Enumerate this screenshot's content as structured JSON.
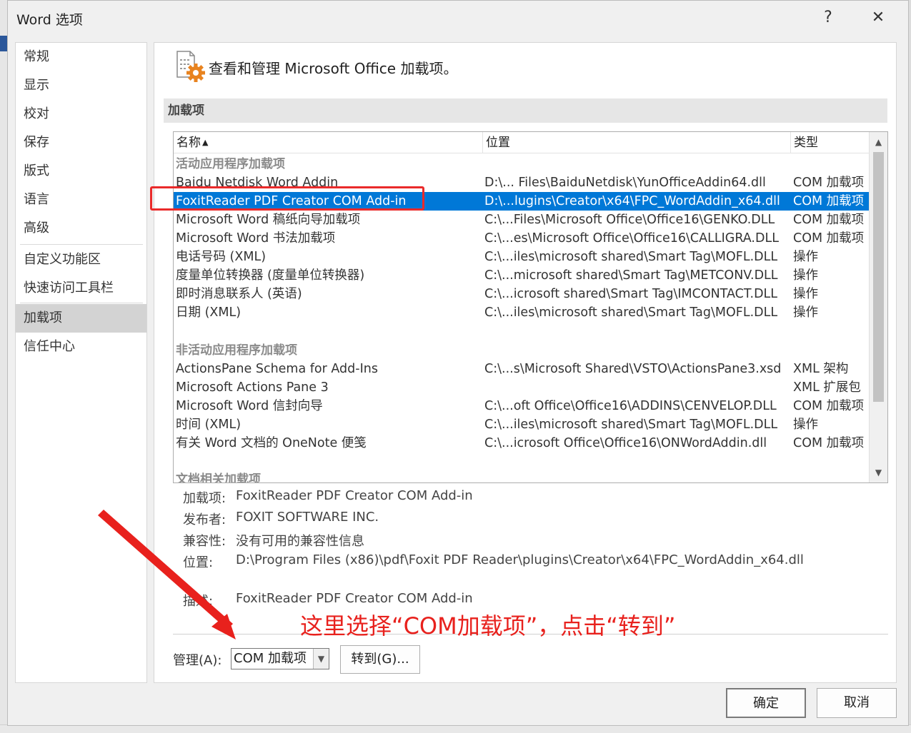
{
  "window": {
    "title": "Word 选项",
    "help": "?",
    "close": "✕"
  },
  "nav": {
    "items": [
      {
        "label": "常规"
      },
      {
        "label": "显示"
      },
      {
        "label": "校对"
      },
      {
        "label": "保存"
      },
      {
        "label": "版式"
      },
      {
        "label": "语言"
      },
      {
        "label": "高级"
      },
      {
        "label": "自定义功能区"
      },
      {
        "label": "快速访问工具栏"
      },
      {
        "label": "加载项",
        "active": true
      },
      {
        "label": "信任中心"
      }
    ]
  },
  "header": {
    "text": "查看和管理 Microsoft Office 加载项。",
    "icon": "addin-gear-icon"
  },
  "section": {
    "title": "加载项"
  },
  "list": {
    "columns": {
      "name": "名称",
      "sort": "▲",
      "location": "位置",
      "type": "类型"
    },
    "groups": {
      "active": "活动应用程序加载项",
      "inactive": "非活动应用程序加载项",
      "document": "文档相关加载项"
    },
    "active_rows": [
      {
        "name": "Baidu Netdisk Word Addin",
        "location": "D:\\... Files\\BaiduNetdisk\\YunOfficeAddin64.dll",
        "type": "COM 加载项"
      },
      {
        "name": "FoxitReader PDF Creator COM Add-in",
        "location": "D:\\...lugins\\Creator\\x64\\FPC_WordAddin_x64.dll",
        "type": "COM 加载项",
        "selected": true
      },
      {
        "name": "Microsoft Word 稿纸向导加载项",
        "location": "C:\\...Files\\Microsoft Office\\Office16\\GENKO.DLL",
        "type": "COM 加载项"
      },
      {
        "name": "Microsoft Word 书法加载项",
        "location": "C:\\...es\\Microsoft Office\\Office16\\CALLIGRA.DLL",
        "type": "COM 加载项"
      },
      {
        "name": "电话号码 (XML)",
        "location": "C:\\...iles\\microsoft shared\\Smart Tag\\MOFL.DLL",
        "type": "操作"
      },
      {
        "name": "度量单位转换器 (度量单位转换器)",
        "location": "C:\\...microsoft shared\\Smart Tag\\METCONV.DLL",
        "type": "操作"
      },
      {
        "name": "即时消息联系人 (英语)",
        "location": "C:\\...icrosoft shared\\Smart Tag\\IMCONTACT.DLL",
        "type": "操作"
      },
      {
        "name": "日期 (XML)",
        "location": "C:\\...iles\\microsoft shared\\Smart Tag\\MOFL.DLL",
        "type": "操作"
      }
    ],
    "inactive_rows": [
      {
        "name": "ActionsPane Schema for Add-Ins",
        "location": "C:\\...s\\Microsoft Shared\\VSTO\\ActionsPane3.xsd",
        "type": "XML 架构"
      },
      {
        "name": "Microsoft Actions Pane 3",
        "location": "",
        "type": "XML 扩展包"
      },
      {
        "name": "Microsoft Word 信封向导",
        "location": "C:\\...oft Office\\Office16\\ADDINS\\CENVELOP.DLL",
        "type": "COM 加载项"
      },
      {
        "name": "时间 (XML)",
        "location": "C:\\...iles\\microsoft shared\\Smart Tag\\MOFL.DLL",
        "type": "操作"
      },
      {
        "name": "有关 Word 文档的 OneNote 便笺",
        "location": "C:\\...icrosoft Office\\Office16\\ONWordAddin.dll",
        "type": "COM 加载项"
      }
    ]
  },
  "details": {
    "addin_label": "加载项:",
    "addin_value": "FoxitReader PDF Creator COM Add-in",
    "publisher_label": "发布者:",
    "publisher_value": "FOXIT SOFTWARE INC.",
    "compat_label": "兼容性:",
    "compat_value": "没有可用的兼容性信息",
    "location_label": "位置:",
    "location_value": "D:\\Program Files (x86)\\pdf\\Foxit PDF Reader\\plugins\\Creator\\x64\\FPC_WordAddin_x64.dll",
    "desc_label": "描述:",
    "desc_value": "FoxitReader PDF Creator COM Add-in"
  },
  "manage": {
    "label": "管理(A):",
    "selected": "COM 加载项",
    "go": "转到(G)..."
  },
  "buttons": {
    "ok": "确定",
    "cancel": "取消"
  },
  "annotation": {
    "note": "这里选择“COM加载项”，点击“转到”",
    "color": "#e8211d"
  }
}
